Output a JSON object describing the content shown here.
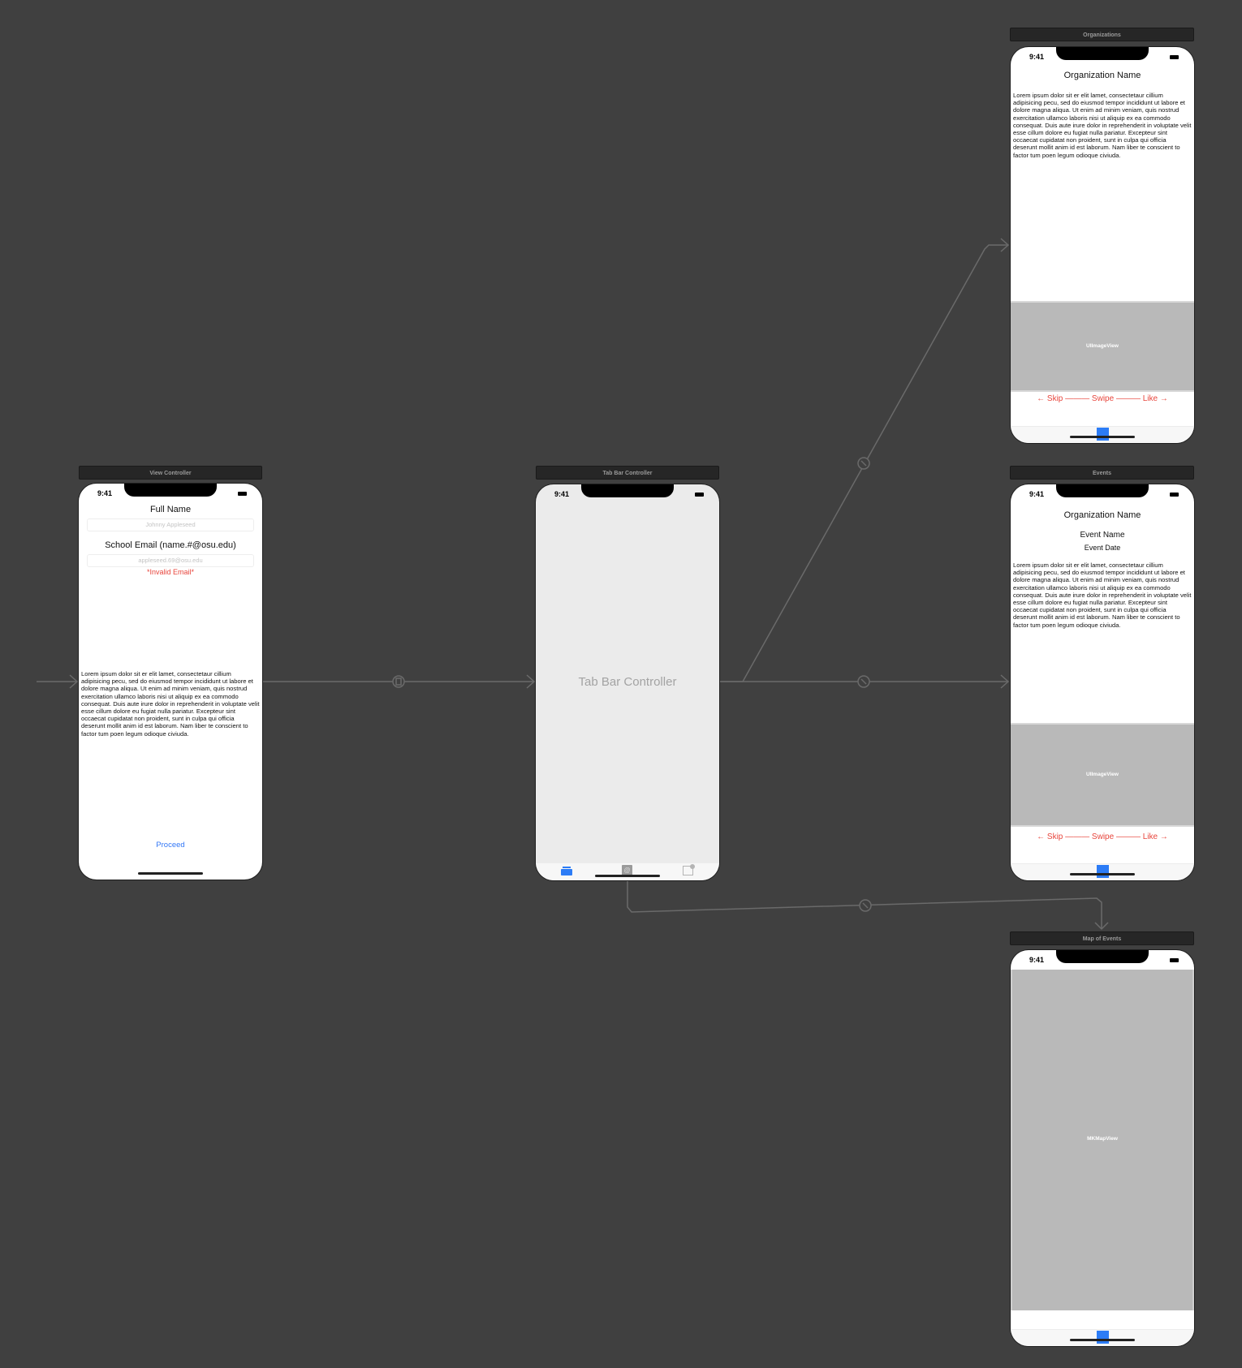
{
  "canvas": {
    "background": "#404040"
  },
  "scenes": {
    "view_controller": {
      "title": "View Controller",
      "status_time": "9:41",
      "full_name_label": "Full Name",
      "full_name_placeholder": "Johnny Appleseed",
      "email_label": "School Email (name.#@osu.edu)",
      "email_placeholder": "appleseed.69@osu.edu",
      "error_text": "*Invalid Email*",
      "body_text": "Lorem ipsum dolor sit er elit lamet, consectetaur cillium adipisicing pecu, sed do eiusmod tempor incididunt ut labore et dolore magna aliqua. Ut enim ad minim veniam, quis nostrud exercitation ullamco laboris nisi ut aliquip ex ea commodo consequat. Duis aute irure dolor in reprehenderit in voluptate velit esse cillum dolore eu fugiat nulla pariatur. Excepteur sint occaecat cupidatat non proident, sunt in culpa qui officia deserunt mollit anim id est laborum. Nam liber te conscient to factor tum poen legum odioque civiuda.",
      "proceed_label": "Proceed"
    },
    "tab_bar_controller": {
      "title": "Tab Bar Controller",
      "status_time": "9:41",
      "center_label": "Tab Bar Controller",
      "tabs": [
        {
          "icon": "stack-icon",
          "selected": true
        },
        {
          "icon": "at-icon",
          "selected": false
        },
        {
          "icon": "map-pin-icon",
          "selected": false
        }
      ]
    },
    "organizations": {
      "title": "Organizations",
      "status_time": "9:41",
      "org_name": "Organization Name",
      "body_text": "Lorem ipsum dolor sit er elit lamet, consectetaur cillium adipisicing pecu, sed do eiusmod tempor incididunt ut labore et dolore magna aliqua. Ut enim ad minim veniam, quis nostrud exercitation ullamco laboris nisi ut aliquip ex ea commodo consequat. Duis aute irure dolor in reprehenderit in voluptate velit esse cillum dolore eu fugiat nulla pariatur. Excepteur sint occaecat cupidatat non proident, sunt in culpa qui officia deserunt mollit anim id est laborum. Nam liber te conscient to factor tum poen legum odioque civiuda.",
      "image_view_label": "UIImageView",
      "swipe_text": "← Skip ——— Swipe ——— Like →"
    },
    "events": {
      "title": "Events",
      "status_time": "9:41",
      "org_name": "Organization Name",
      "event_name": "Event Name",
      "event_date": "Event Date",
      "body_text": "Lorem ipsum dolor sit er elit lamet, consectetaur cillium adipisicing pecu, sed do eiusmod tempor incididunt ut labore et dolore magna aliqua. Ut enim ad minim veniam, quis nostrud exercitation ullamco laboris nisi ut aliquip ex ea commodo consequat. Duis aute irure dolor in reprehenderit in voluptate velit esse cillum dolore eu fugiat nulla pariatur. Excepteur sint occaecat cupidatat non proident, sunt in culpa qui officia deserunt mollit anim id est laborum. Nam liber te conscient to factor tum poen legum odioque civiuda.",
      "image_view_label": "UIImageView",
      "swipe_text": "← Skip ——— Swipe ——— Like →"
    },
    "map_of_events": {
      "title": "Map of Events",
      "status_time": "9:41",
      "map_view_label": "MKMapView"
    }
  },
  "colors": {
    "accent_blue": "#2c7cf6",
    "link_blue": "#3478f6",
    "error_red": "#e8453c",
    "segue_line": "#6a6a6a"
  },
  "segues": [
    {
      "from": "entry",
      "to": "View Controller",
      "type": "initial"
    },
    {
      "from": "View Controller",
      "to": "Tab Bar Controller",
      "type": "present-modally"
    },
    {
      "from": "Tab Bar Controller",
      "to": "Organizations",
      "type": "relationship"
    },
    {
      "from": "Tab Bar Controller",
      "to": "Events",
      "type": "relationship"
    },
    {
      "from": "Tab Bar Controller",
      "to": "Map of Events",
      "type": "relationship"
    }
  ]
}
